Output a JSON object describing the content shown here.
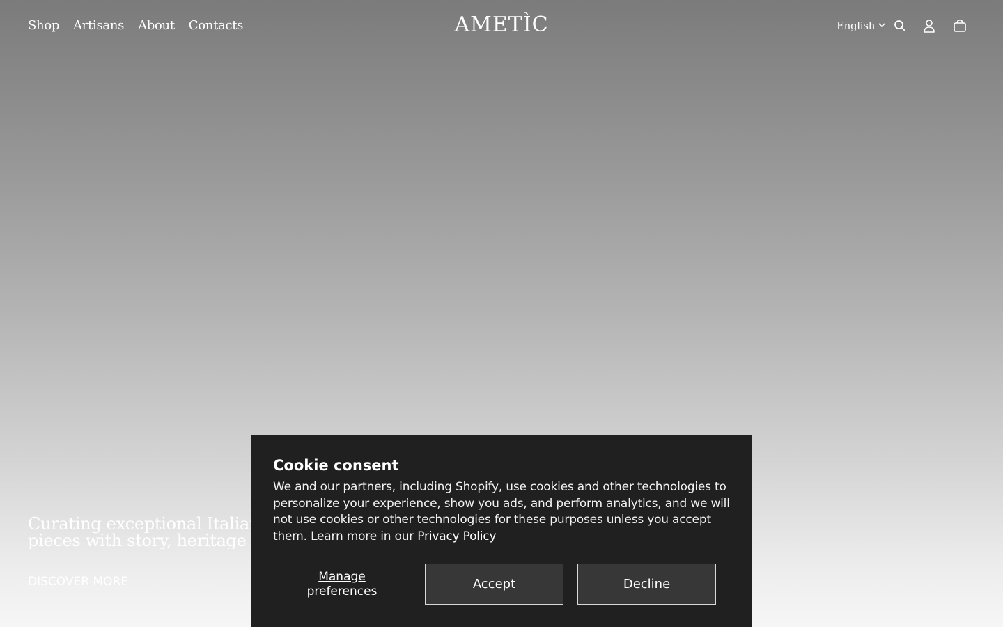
{
  "header": {
    "nav": [
      "Shop",
      "Artisans",
      "About",
      "Contacts"
    ],
    "logo": "AMETÌC",
    "language": "English",
    "icons": [
      "search-icon",
      "account-icon",
      "cart-icon"
    ]
  },
  "hero": {
    "text_line1": "Curating exceptional Italian c",
    "text_line2": "pieces with story, heritage and",
    "cta": "DISCOVER MORE"
  },
  "cookie": {
    "title": "Cookie consent",
    "body": "We and our partners, including Shopify, use cookies and other technologies to personalize your experience, show you ads, and perform analytics, and we will not use cookies or other technologies for these purposes unless you accept them. Learn more in our ",
    "policy_link": "Privacy Policy",
    "manage_line1": "Manage",
    "manage_line2": "preferences",
    "accept": "Accept",
    "decline": "Decline"
  }
}
